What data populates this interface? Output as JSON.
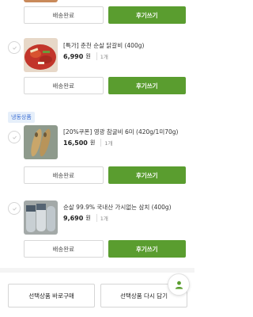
{
  "buttons": {
    "status_label": "배송완료",
    "review_label": "후기쓰기"
  },
  "section_tag": "냉동상품",
  "products": [
    {
      "name": "[특가] 춘천 순살 닭갈비 (400g)",
      "price": "6,990",
      "won": "원",
      "qty": "1개"
    },
    {
      "name": "[20%쿠폰] 영광 참굴비 6미 (420g/1미70g)",
      "price": "16,500",
      "won": "원",
      "qty": "1개"
    },
    {
      "name": "순살 99.9% 국내산 가시없는 삼치 (400g)",
      "price": "9,690",
      "won": "원",
      "qty": "1개"
    }
  ],
  "bottom": {
    "buy_again": "선택상품 바로구매",
    "cart_again": "선택상품 다시 담기"
  },
  "colors": {
    "accent": "#5a9d2f",
    "tag_bg": "#e6effa",
    "tag_text": "#3d6fd4"
  },
  "icons": {
    "check": "check-icon",
    "fab": "person-icon"
  }
}
